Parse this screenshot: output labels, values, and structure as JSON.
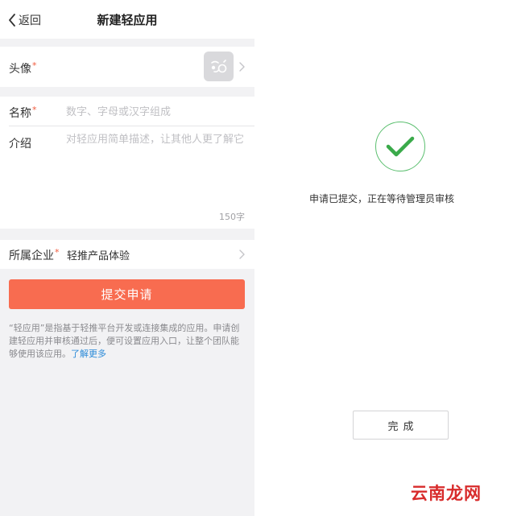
{
  "left": {
    "navbar": {
      "back_label": "返回",
      "title": "新建轻应用"
    },
    "form": {
      "avatar_label": "头像",
      "name_label": "名称",
      "name_placeholder": "数字、字母或汉字组成",
      "intro_label": "介绍",
      "intro_placeholder": "对轻应用简单描述，让其他人更了解它",
      "intro_counter": "150字",
      "company_label": "所属企业",
      "company_value": "轻推产品体验",
      "required_mark": "*"
    },
    "submit_label": "提交申请",
    "note_text": "“轻应用”是指基于轻推平台开发或连接集成的应用。申请创建轻应用并审核通过后，便可设置应用入口，让整个团队能够使用该应用。",
    "note_link": "了解更多"
  },
  "right": {
    "message": "申请已提交，正在等待管理员审核",
    "done_label": "完成"
  },
  "watermark": "云南龙网",
  "icons": {
    "back": "chevron-left-icon",
    "avatar": "app-avatar-placeholder-icon",
    "arrow": "chevron-right-icon",
    "success": "checkmark-icon"
  },
  "colors": {
    "accent": "#f86c50",
    "required": "#f05a3c",
    "link": "#2a8ad8",
    "success": "#3aaa4a",
    "background": "#f2f2f4"
  }
}
